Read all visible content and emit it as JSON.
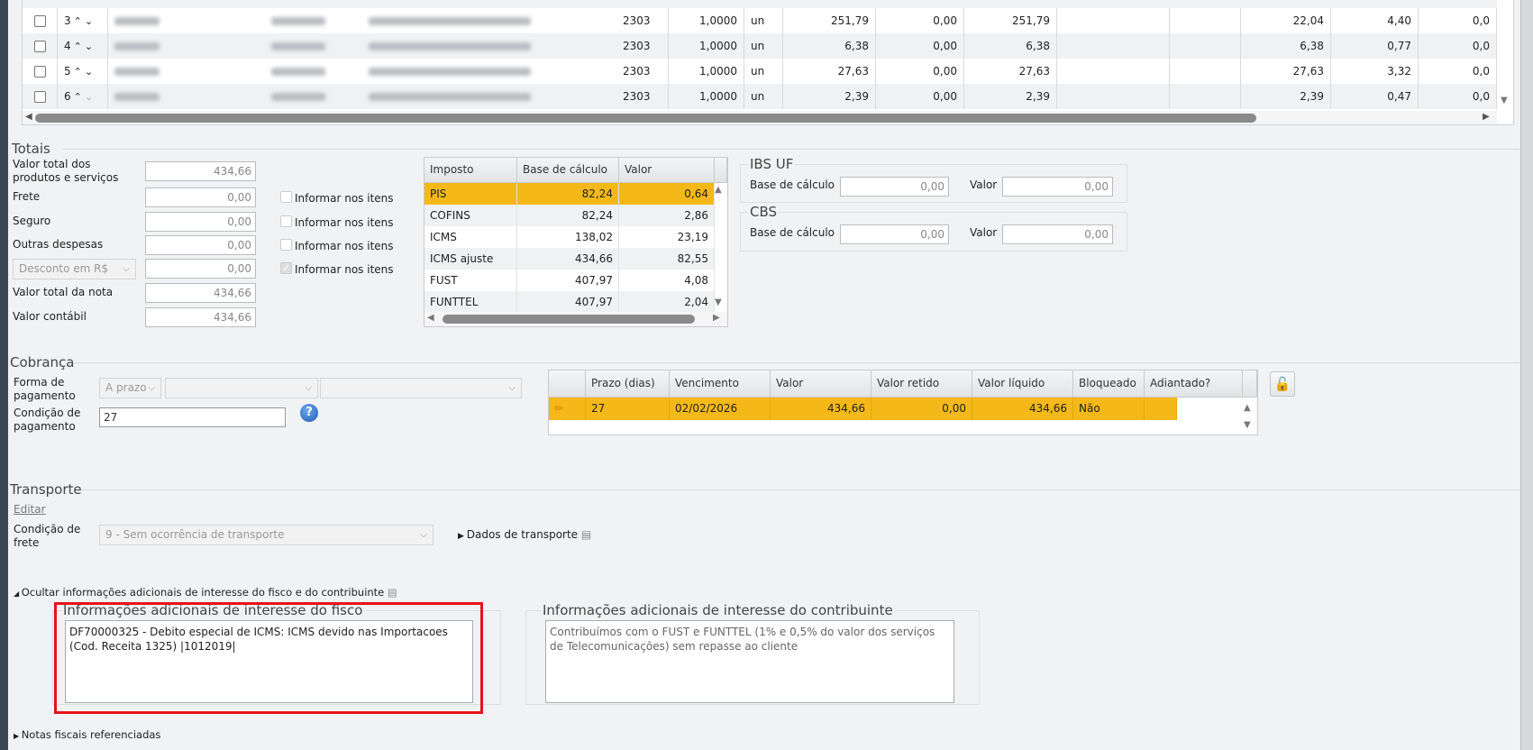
{
  "items_grid": {
    "rows": [
      {
        "index": "3",
        "cfop": "2303",
        "qty": "1,0000",
        "unit": "un",
        "c1": "251,79",
        "c2": "0,00",
        "c3": "251,79",
        "c4": "",
        "c5": "",
        "c6": "22,04",
        "c7": "4,40",
        "c8": "0,0"
      },
      {
        "index": "4",
        "cfop": "2303",
        "qty": "1,0000",
        "unit": "un",
        "c1": "6,38",
        "c2": "0,00",
        "c3": "6,38",
        "c4": "",
        "c5": "",
        "c6": "6,38",
        "c7": "0,77",
        "c8": "0,0"
      },
      {
        "index": "5",
        "cfop": "2303",
        "qty": "1,0000",
        "unit": "un",
        "c1": "27,63",
        "c2": "0,00",
        "c3": "27,63",
        "c4": "",
        "c5": "",
        "c6": "27,63",
        "c7": "3,32",
        "c8": "0,0"
      },
      {
        "index": "6",
        "cfop": "2303",
        "qty": "1,0000",
        "unit": "un",
        "c1": "2,39",
        "c2": "0,00",
        "c3": "2,39",
        "c4": "",
        "c5": "",
        "c6": "2,39",
        "c7": "0,47",
        "c8": "0,0"
      }
    ]
  },
  "totais": {
    "title": "Totais",
    "fields": [
      {
        "label": "Valor total dos produtos e serviços",
        "value": "434,66"
      },
      {
        "label": "Frete",
        "value": "0,00",
        "checkbox": "Informar nos itens",
        "checked": false
      },
      {
        "label": "Seguro",
        "value": "0,00",
        "checkbox": "Informar nos itens",
        "checked": false
      },
      {
        "label": "Outras despesas",
        "value": "0,00",
        "checkbox": "Informar nos itens",
        "checked": false
      },
      {
        "select": "Desconto em R$",
        "value": "0,00",
        "checkbox": "Informar nos itens",
        "checked": true
      },
      {
        "label": "Valor total da nota",
        "value": "434,66"
      },
      {
        "label": "Valor contábil",
        "value": "434,66"
      }
    ],
    "tax_table": {
      "headers": [
        "Imposto",
        "Base de cálculo",
        "Valor"
      ],
      "rows": [
        [
          "PIS",
          "82,24",
          "0,64"
        ],
        [
          "COFINS",
          "82,24",
          "2,86"
        ],
        [
          "ICMS",
          "138,02",
          "23,19"
        ],
        [
          "ICMS ajuste",
          "434,66",
          "82,55"
        ],
        [
          "FUST",
          "407,97",
          "4,08"
        ],
        [
          "FUNTTEL",
          "407,97",
          "2,04"
        ]
      ],
      "selected_row": 0
    },
    "ibs_uf": {
      "title": "IBS UF",
      "base_label": "Base de cálculo",
      "base": "0,00",
      "valor_label": "Valor",
      "valor": "0,00"
    },
    "cbs": {
      "title": "CBS",
      "base_label": "Base de cálculo",
      "base": "0,00",
      "valor_label": "Valor",
      "valor": "0,00"
    }
  },
  "cobranca": {
    "title": "Cobrança",
    "forma_label": "Forma de pagamento",
    "forma_value": "A prazo",
    "condicao_label": "Condição de pagamento",
    "condicao_value": "27",
    "grid": {
      "headers": [
        "",
        "Prazo (dias)",
        "Vencimento",
        "Valor",
        "Valor retido",
        "Valor líquido",
        "Bloqueado",
        "Adiantado?"
      ],
      "rows": [
        [
          "",
          "27",
          "02/02/2026",
          "434,66",
          "0,00",
          "434,66",
          "Não",
          ""
        ]
      ]
    }
  },
  "transporte": {
    "title": "Transporte",
    "edit_link": "Editar",
    "frete_label": "Condição de frete",
    "frete_value": "9 - Sem ocorrência de transporte",
    "dados_link": "Dados de transporte"
  },
  "info": {
    "toggle": "Ocultar informações adicionais de interesse do fisco e do contribuinte",
    "fisco_title": "Informações adicionais de interesse do fisco",
    "fisco_text": "DF70000325 - Debito especial de ICMS: ICMS devido nas Importacoes (Cod. Receita 1325) |1012019|",
    "contrib_title": "Informações adicionais de interesse do contribuinte",
    "contrib_text": "Contribuímos com o FUST e FUNTTEL (1% e 0,5% do valor dos serviços de Telecomunicações) sem repasse ao cliente",
    "highlight_color": "#e8121b"
  },
  "notas": {
    "label": "Notas fiscais referenciadas"
  },
  "colors": {
    "selected_row": "#f4b818",
    "background": "#f1f2f3"
  }
}
